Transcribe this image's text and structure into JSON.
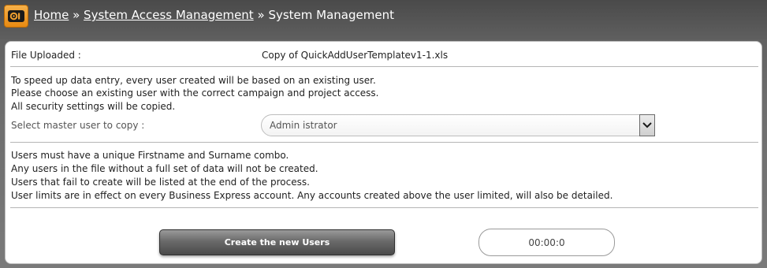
{
  "breadcrumb": {
    "home": "Home",
    "sep1": "»",
    "system_access": "System Access Management",
    "sep2": "»",
    "current": "System Management"
  },
  "file": {
    "label": "File Uploaded :",
    "value": "Copy of QuickAddUserTemplatev1-1.xls"
  },
  "info": {
    "line1": "To speed up data entry, every user created will be based on an existing user.",
    "line2": "Please choose an existing user with the correct campaign and project access.",
    "line3": "All security settings will be copied."
  },
  "master_user": {
    "label": "Select master user to copy :",
    "selected": "Admin istrator"
  },
  "rules": {
    "line1": "Users must have a unique Firstname and Surname combo.",
    "line2": "Any users in the file without a full set of data will not be created.",
    "line3": "Users that fail to create will be listed at the end of the process.",
    "line4": "User limits are in effect on every Business Express account. Any accounts created above the user limited, will also be detailed."
  },
  "actions": {
    "create_label": "Create the new Users",
    "timer": "00:00:0"
  },
  "colors": {
    "header_bg": "#555555",
    "logo_orange": "#f0a030",
    "button_dark": "#5a5a5a"
  }
}
